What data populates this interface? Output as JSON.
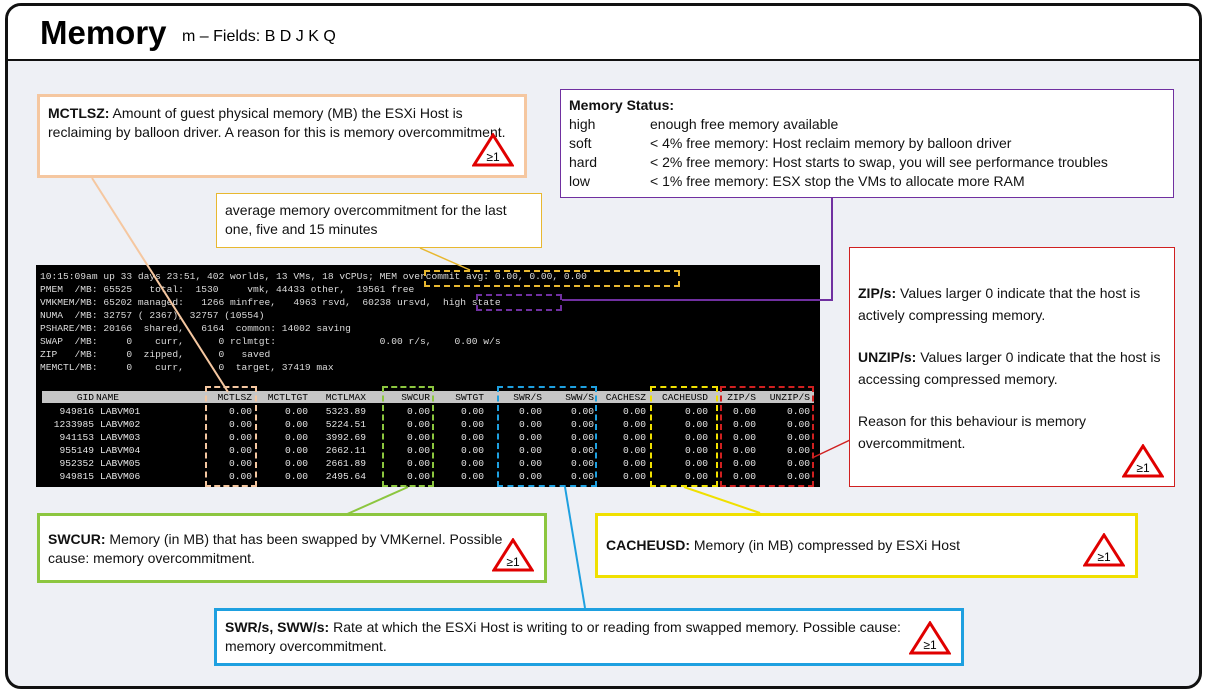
{
  "header": {
    "title": "Memory",
    "subtitle": "m – Fields: B D J K Q"
  },
  "callouts": {
    "mctlsz": {
      "term": "MCTLSZ:",
      "text": " Amount of guest physical memory (MB) the ESXi Host is reclaiming by balloon driver. A reason for this is memory overcommitment."
    },
    "avg": {
      "text": "average memory overcommitment for the last one, five and 15 minutes"
    },
    "status": {
      "title": "Memory Status:",
      "rows": [
        {
          "state": "high",
          "desc": "enough free memory available"
        },
        {
          "state": "soft",
          "desc": "< 4% free memory: Host reclaim memory by balloon driver"
        },
        {
          "state": "hard",
          "desc": "< 2% free memory: Host starts to swap, you will see performance troubles"
        },
        {
          "state": "low",
          "desc": "< 1% free memory: ESX stop the VMs to allocate more RAM"
        }
      ]
    },
    "zip": {
      "zip_term": "ZIP/s:",
      "zip_text": " Values larger 0 indicate that the host is actively compressing memory.",
      "unzip_term": "UNZIP/s:",
      "unzip_text": " Values larger 0 indicate that the host is accessing compressed memory.",
      "reason": "Reason for this behaviour is memory overcommitment."
    },
    "swcur": {
      "term": "SWCUR:",
      "text": " Memory (in MB) that has been swapped by VMKernel. Possible cause: memory overcommitment."
    },
    "cacheusd": {
      "term": "CACHEUSD:",
      "text": " Memory (in MB) compressed by ESXi Host"
    },
    "swr": {
      "term": "SWR/s, SWW/s:",
      "text": " Rate at which the ESXi Host is writing to or reading from swapped memory. Possible cause: memory overcommitment."
    },
    "warning_label": "≥1"
  },
  "terminal": {
    "lines": [
      "10:15:09am up 33 days 23:51, 402 worlds, 13 VMs, 18 vCPUs; MEM overcommit avg: 0.00, 0.00, 0.00",
      "PMEM  /MB: 65525   total:  1530     vmk, 44433 other,  19561 free",
      "VMKMEM/MB: 65202 managed:   1266 minfree,   4963 rsvd,  60238 ursvd,  high state",
      "NUMA  /MB: 32757 ( 2367), 32757 (10554)",
      "PSHARE/MB: 20166  shared,   6164  common: 14002 saving",
      "SWAP  /MB:     0    curr,      0 rclmtgt:                  0.00 r/s,    0.00 w/s",
      "ZIP   /MB:     0  zipped,      0   saved",
      "MEMCTL/MB:     0    curr,      0  target, 37419 max"
    ],
    "columns": [
      "GID",
      "NAME",
      "MCTLSZ",
      "MCTLTGT",
      "MCTLMAX",
      "SWCUR",
      "SWTGT",
      "SWR/S",
      "SWW/S",
      "CACHESZ",
      "CACHEUSD",
      "ZIP/S",
      "UNZIP/S"
    ],
    "rows": [
      [
        "949816",
        "LABVM01",
        "0.00",
        "0.00",
        "5323.89",
        "0.00",
        "0.00",
        "0.00",
        "0.00",
        "0.00",
        "0.00",
        "0.00",
        "0.00"
      ],
      [
        "1233985",
        "LABVM02",
        "0.00",
        "0.00",
        "5224.51",
        "0.00",
        "0.00",
        "0.00",
        "0.00",
        "0.00",
        "0.00",
        "0.00",
        "0.00"
      ],
      [
        "941153",
        "LABVM03",
        "0.00",
        "0.00",
        "3992.69",
        "0.00",
        "0.00",
        "0.00",
        "0.00",
        "0.00",
        "0.00",
        "0.00",
        "0.00"
      ],
      [
        "955149",
        "LABVM04",
        "0.00",
        "0.00",
        "2662.11",
        "0.00",
        "0.00",
        "0.00",
        "0.00",
        "0.00",
        "0.00",
        "0.00",
        "0.00"
      ],
      [
        "952352",
        "LABVM05",
        "0.00",
        "0.00",
        "2661.89",
        "0.00",
        "0.00",
        "0.00",
        "0.00",
        "0.00",
        "0.00",
        "0.00",
        "0.00"
      ],
      [
        "949815",
        "LABVM06",
        "0.00",
        "0.00",
        "2495.64",
        "0.00",
        "0.00",
        "0.00",
        "0.00",
        "0.00",
        "0.00",
        "0.00",
        "0.00"
      ]
    ]
  },
  "colors": {
    "mctlsz": "#f5c7a0",
    "avg": "#e8b830",
    "status": "#7030a0",
    "zip": "#d02020",
    "swcur": "#8cc63f",
    "cacheusd": "#f0e000",
    "swr": "#1ea0e0",
    "warning": "#e00000"
  }
}
